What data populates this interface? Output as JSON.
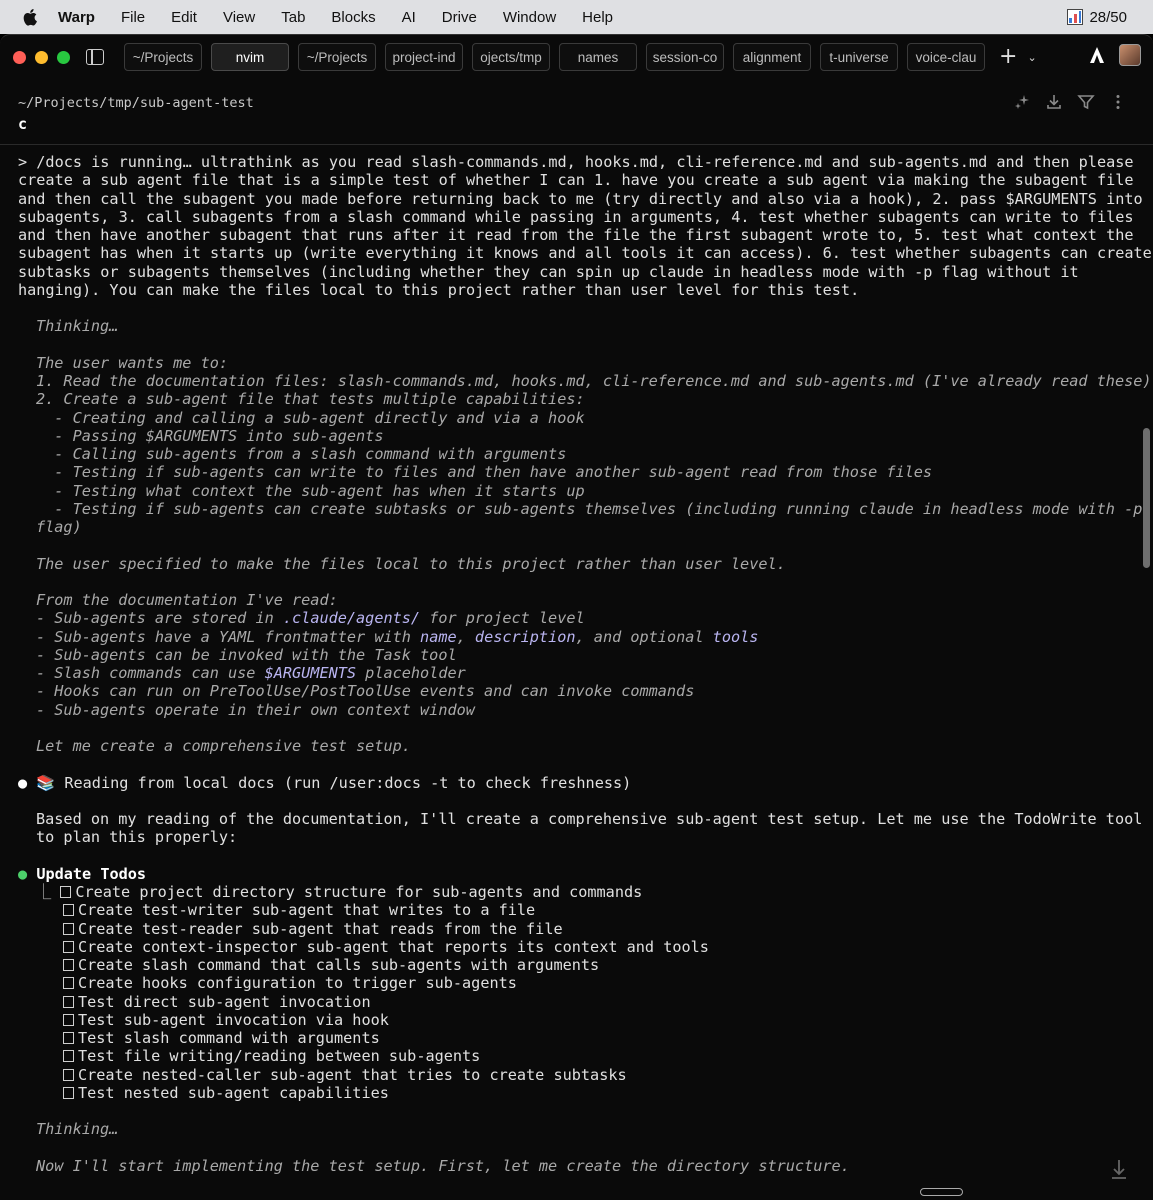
{
  "menubar": {
    "app": "Warp",
    "items": [
      "File",
      "Edit",
      "View",
      "Tab",
      "Blocks",
      "AI",
      "Drive",
      "Window",
      "Help"
    ],
    "status": "28/50"
  },
  "tabs": [
    "~/Projects",
    "nvim",
    "~/Projects",
    "project-ind",
    "ojects/tmp",
    "names",
    "session-co",
    "alignment",
    "t-universe",
    "voice-clau"
  ],
  "block": {
    "path": "~/Projects/tmp/sub-agent-test",
    "command": "c"
  },
  "prompt_lines": [
    "> /docs is running… ultrathink as you read slash-commands.md, hooks.md, cli-reference.md and sub-agents.md and then please",
    "create a sub agent file that is a simple test of whether I can 1. have you create a sub agent via making the subagent file",
    "and then call the subagent you made before returning back to me (try directly and also via a hook), 2. pass $ARGUMENTS into",
    "subagents, 3. call subagents from a slash command while passing in arguments, 4. test whether subagents can write to files",
    "and then have another subagent that runs after it read from the file the first subagent wrote to, 5. test what context the",
    "subagent has when it starts up (write everything it knows and all tools it can access). 6. test whether subagents can create",
    "subtasks or subagents themselves (including whether they can spin up claude in headless mode with -p flag without it",
    "hanging). You can make the files local to this project rather than user level for this test."
  ],
  "thinking_label": "Thinking…",
  "thinking_lines": [
    "The user wants me to:",
    "1. Read the documentation files: slash-commands.md, hooks.md, cli-reference.md and sub-agents.md (I've already read these)",
    "2. Create a sub-agent file that tests multiple capabilities:",
    "  - Creating and calling a sub-agent directly and via a hook",
    "  - Passing $ARGUMENTS into sub-agents",
    "  - Calling sub-agents from a slash command with arguments",
    "  - Testing if sub-agents can write to files and then have another sub-agent read from those files",
    "  - Testing what context the sub-agent has when it starts up",
    "  - Testing if sub-agents can create subtasks or sub-agents themselves (including running claude in headless mode with -p",
    "flag)"
  ],
  "thinking_local": "The user specified to make the files local to this project rather than user level.",
  "docs_read": {
    "intro": "From the documentation I've read:",
    "l1_a": "- Sub-agents are stored in ",
    "l1_hl": ".claude/agents/",
    "l1_b": " for project level",
    "l2_a": "- Sub-agents have a YAML frontmatter with ",
    "l2_hl1": "name",
    "l2_sep1": ", ",
    "l2_hl2": "description",
    "l2_sep2": ", and optional ",
    "l2_hl3": "tools",
    "l3": "- Sub-agents can be invoked with the Task tool",
    "l4_a": "- Slash commands can use ",
    "l4_hl": "$ARGUMENTS",
    "l4_b": " placeholder",
    "l5": "- Hooks can run on PreToolUse/PostToolUse events and can invoke commands",
    "l6": "- Sub-agents operate in their own context window"
  },
  "thinking_end": "Let me create a comprehensive test setup.",
  "reading_bullet": "📚 Reading from local docs (run /user:docs -t to check freshness)",
  "based_lines": [
    "Based on my reading of the documentation, I'll create a comprehensive sub-agent test setup. Let me use the TodoWrite tool",
    "to plan this properly:"
  ],
  "todos_title": "Update Todos",
  "todos": [
    "Create project directory structure for sub-agents and commands",
    "Create test-writer sub-agent that writes to a file",
    "Create test-reader sub-agent that reads from the file",
    "Create context-inspector sub-agent that reports its context and tools",
    "Create slash command that calls sub-agents with arguments",
    "Create hooks configuration to trigger sub-agents",
    "Test direct sub-agent invocation",
    "Test sub-agent invocation via hook",
    "Test slash command with arguments",
    "Test file writing/reading between sub-agents",
    "Create nested-caller sub-agent that tries to create subtasks",
    "Test nested sub-agent capabilities"
  ],
  "thinking2_label": "Thinking…",
  "final_line": "Now I'll start implementing the test setup. First, let me create the directory structure.",
  "colors": {
    "red": "#ff5f57",
    "yellow": "#febc2e",
    "green": "#28c840",
    "bullet_green": "#4cd06a",
    "highlight": "#b9b4f0"
  }
}
